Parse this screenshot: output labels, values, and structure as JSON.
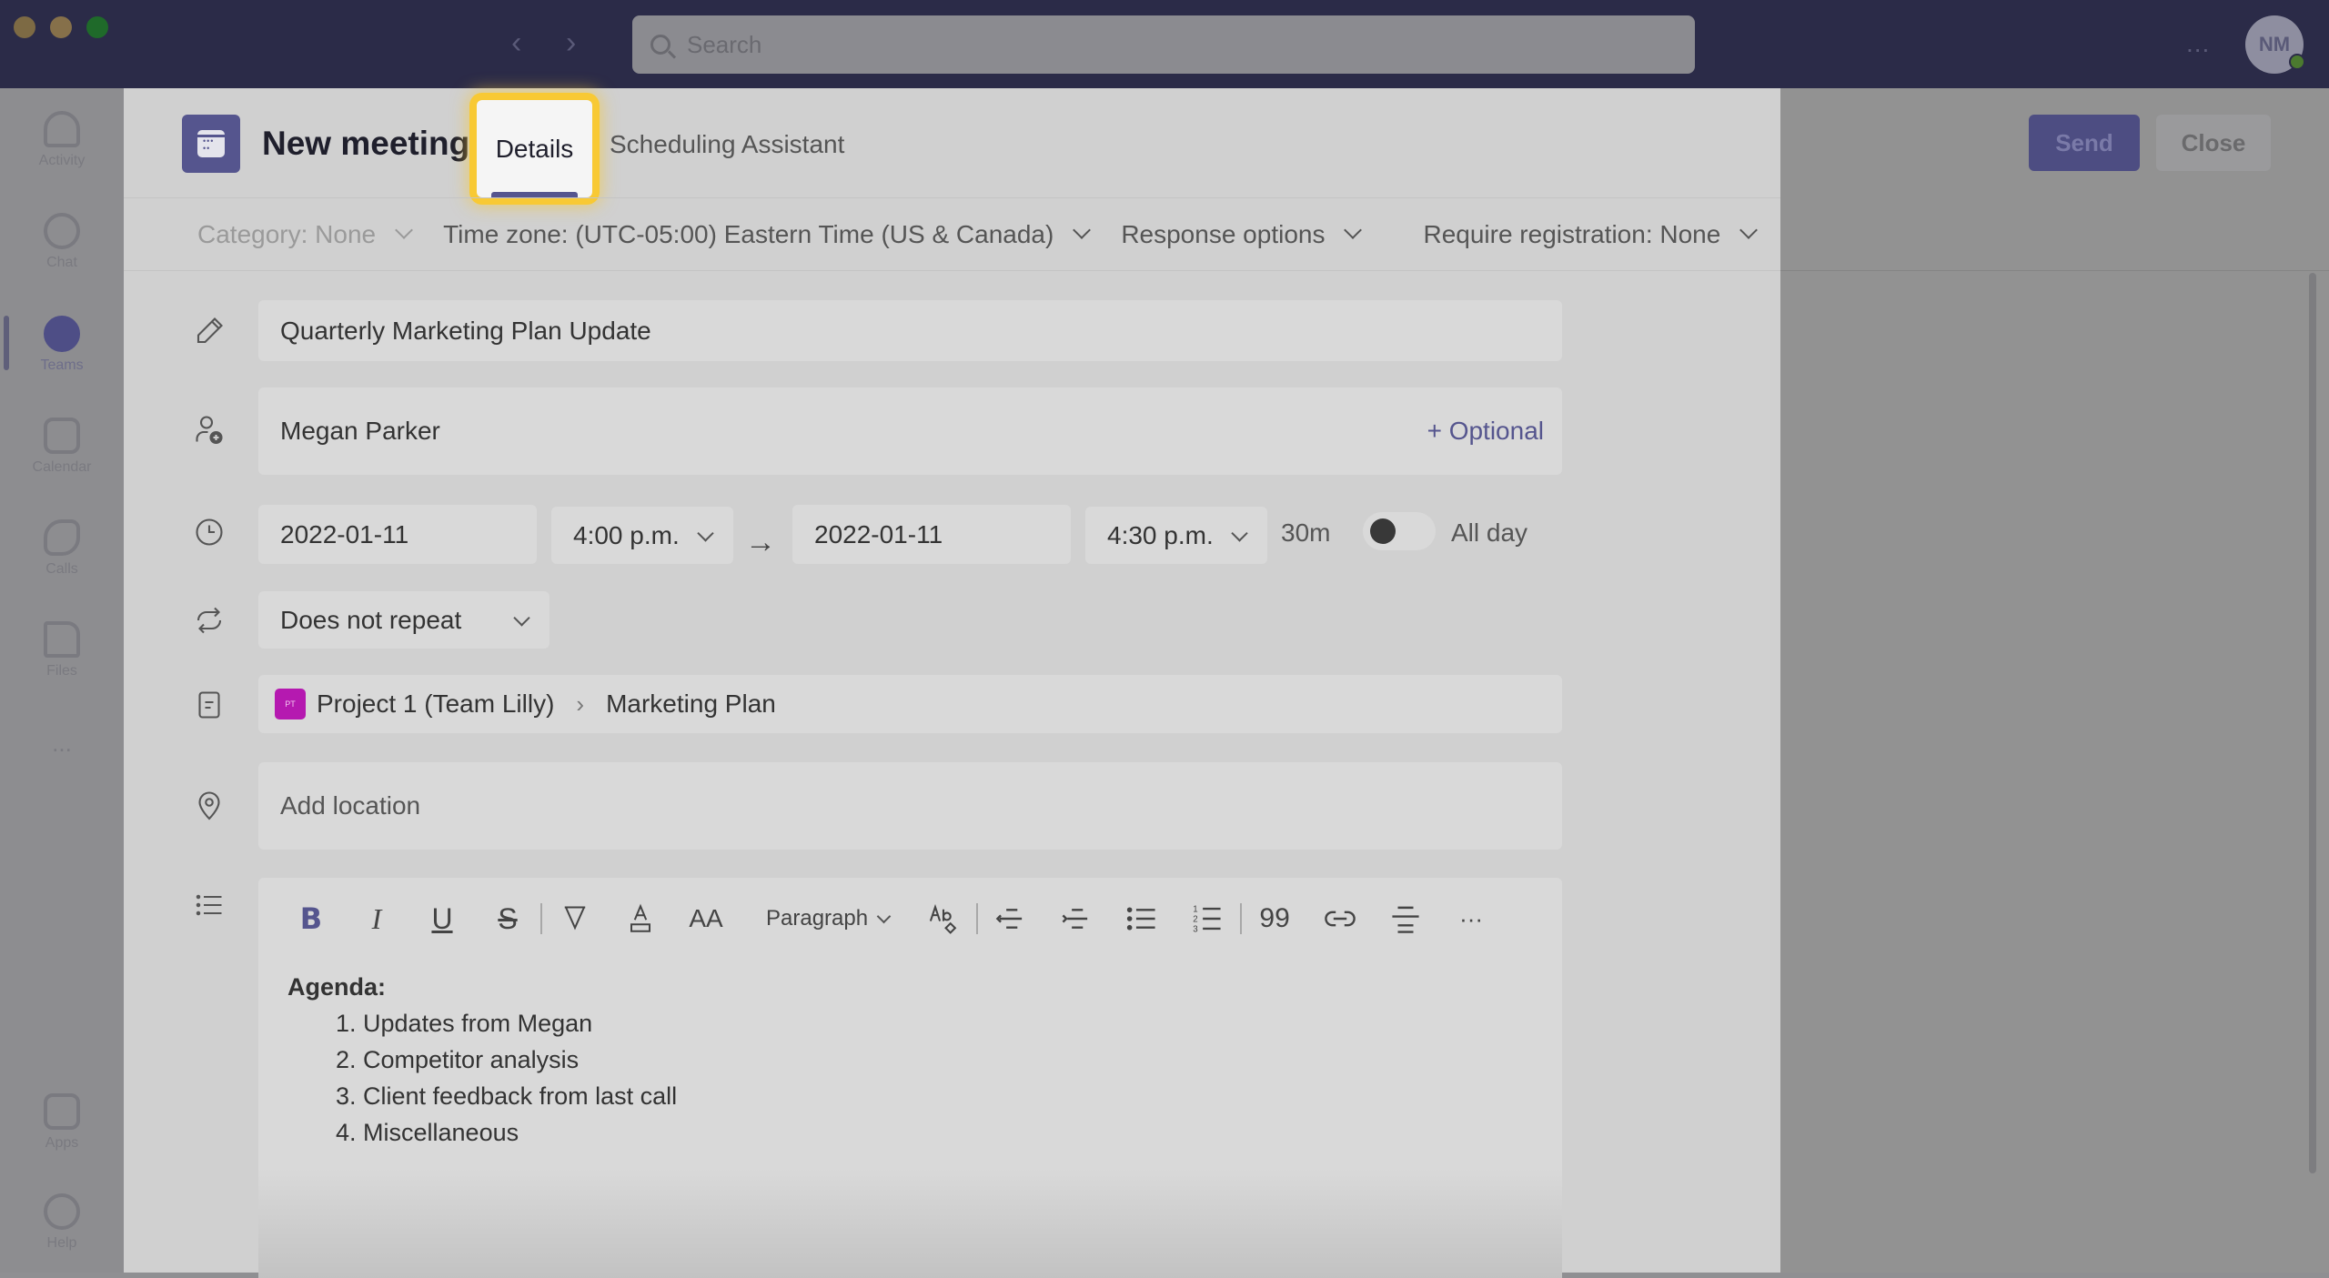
{
  "window": {
    "search_placeholder": "Search",
    "more_label": "...",
    "avatar_initials": "NM",
    "colors": {
      "titlebar": "#2b2b48",
      "accent": "#55558e",
      "highlight": "#f8c934",
      "team_badge": "#b519b0"
    }
  },
  "rail": {
    "items": [
      {
        "label": "Activity",
        "icon": "bell-icon"
      },
      {
        "label": "Chat",
        "icon": "chat-icon"
      },
      {
        "label": "Teams",
        "icon": "teams-icon",
        "active": true
      },
      {
        "label": "Calendar",
        "icon": "calendar-icon"
      },
      {
        "label": "Calls",
        "icon": "phone-icon"
      },
      {
        "label": "Files",
        "icon": "file-icon"
      },
      {
        "label": "...",
        "icon": "more-icon"
      }
    ],
    "bottom": [
      {
        "label": "Apps",
        "icon": "apps-icon"
      },
      {
        "label": "Help",
        "icon": "help-icon"
      }
    ]
  },
  "actions": {
    "send_label": "Send",
    "close_label": "Close"
  },
  "modal": {
    "title": "New meeting",
    "tabs": [
      {
        "label": "Details",
        "selected": true
      },
      {
        "label": "Scheduling Assistant",
        "selected": false
      }
    ],
    "options": {
      "category": "Category: None",
      "time_zone": "Time zone: (UTC-05:00) Eastern Time (US & Canada)",
      "response_options": "Response options",
      "registration": "Require registration: None"
    },
    "title_field": {
      "value": "Quarterly Marketing Plan Update"
    },
    "attendees": {
      "value": "Megan Parker",
      "optional_label": "+ Optional"
    },
    "schedule": {
      "start_date": "2022-01-11",
      "start_time": "4:00 p.m.",
      "end_date": "2022-01-11",
      "end_time": "4:30 p.m.",
      "duration": "30m",
      "all_day_label": "All day",
      "all_day": false
    },
    "repeat": {
      "value": "Does not repeat"
    },
    "channel": {
      "team_initials": "PT",
      "team": "Project 1 (Team Lilly)",
      "channel": "Marketing Plan"
    },
    "location": {
      "placeholder": "Add location"
    },
    "editor": {
      "toolbar": {
        "bold": "B",
        "italic": "I",
        "underline": "U",
        "strike": "S",
        "font_size": "AA",
        "paragraph": "Paragraph",
        "quote": "99",
        "more": "···"
      },
      "heading": "Agenda:",
      "items": [
        "1. Updates from Megan",
        "2. Competitor analysis",
        "3. Client feedback from last call",
        "4. Miscellaneous"
      ]
    }
  }
}
